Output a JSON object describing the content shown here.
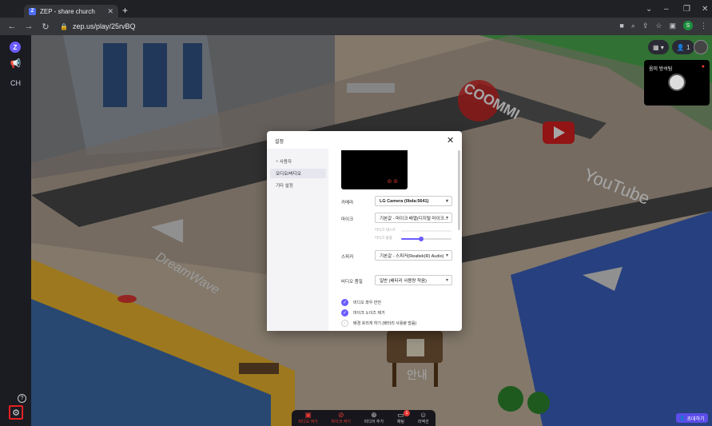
{
  "browser": {
    "tab_title": "ZEP - share church",
    "tab_favicon": "Z",
    "url": "zep.us/play/25rvBQ",
    "profile_initial": "S"
  },
  "sidebar": {
    "logo": "Z",
    "ch_label": "CH"
  },
  "map": {
    "top_controls": {
      "people_count": "1"
    },
    "video_tile": {
      "name": "옴미 방석팀"
    },
    "bottom_bar": {
      "items": [
        {
          "icon": "video-off-icon",
          "label": "비디오 켜기"
        },
        {
          "icon": "mic-off-icon",
          "label": "마이크 켜기"
        },
        {
          "icon": "add-media-icon",
          "label": "미디어 추가"
        },
        {
          "icon": "chat-icon",
          "label": "채팅"
        },
        {
          "icon": "reaction-icon",
          "label": "리액션"
        }
      ],
      "chat_badge": "1"
    },
    "invite_label": "초대하기"
  },
  "modal": {
    "title": "설정",
    "nav": [
      "사용자",
      "오디오/비디오",
      "기타 설정"
    ],
    "camera_label": "카메라",
    "camera_value": "LG Camera (0bda:5641)",
    "mic_label": "마이크",
    "mic_value": "기본값 - 마이크 배열(디지털 마이크...",
    "mic_test_label": "마이크 테스트",
    "mic_volume_label": "마이크 볼륨",
    "mic_volume": 0.4,
    "speaker_label": "스피커",
    "speaker_value": "기본값 - 스피커(Realtek(R) Audio)",
    "video_quality_label": "비디오 품질",
    "video_quality_value": "일반 (배터리 사용량 적음)",
    "checks": [
      {
        "label": "비디오 좌우 반전",
        "checked": true
      },
      {
        "label": "마이크 노이즈 제거",
        "checked": true
      },
      {
        "label": "배경 흐리게 하기 (배터리 사용량 많음)",
        "checked": false
      }
    ]
  },
  "colors": {
    "accent": "#6b5cff",
    "alert": "#e52020",
    "muted_red": "#e53935"
  }
}
